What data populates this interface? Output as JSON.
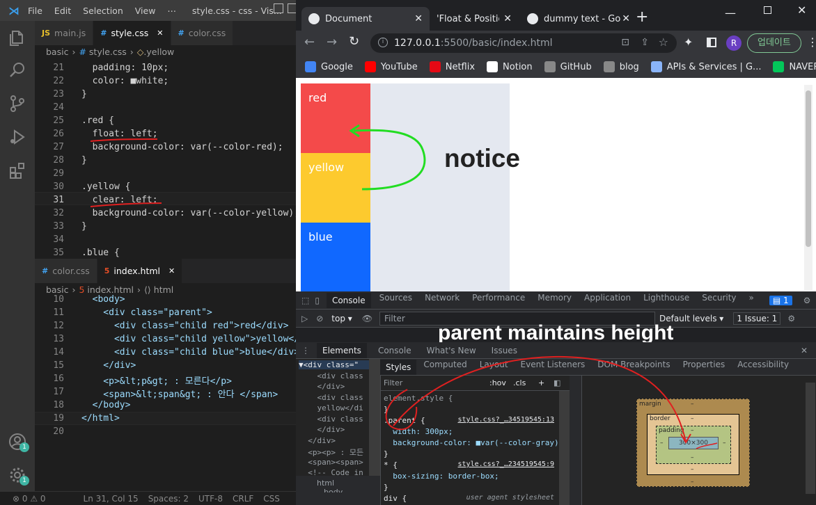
{
  "vscode": {
    "menu": [
      "File",
      "Edit",
      "Selection",
      "View",
      "⋯"
    ],
    "window_title": "style.css - css - Vis...",
    "tabs_top": [
      {
        "label": "main.js",
        "icon": "JS",
        "color": "#e8c02b"
      },
      {
        "label": "style.css",
        "icon": "#",
        "color": "#42a5f5"
      },
      {
        "label": "color.css",
        "icon": "#",
        "color": "#42a5f5"
      }
    ],
    "active_top_close": "✕",
    "breadcrumb_top": [
      "basic",
      "style.css",
      ".yellow"
    ],
    "css_lines": [
      {
        "ln": "21",
        "code": "  padding: 10px;"
      },
      {
        "ln": "22",
        "code": "  color: ■white;"
      },
      {
        "ln": "23",
        "code": "}"
      },
      {
        "ln": "24",
        "code": ""
      },
      {
        "ln": "25",
        "code": ".red {"
      },
      {
        "ln": "26",
        "code": "  float: left;"
      },
      {
        "ln": "27",
        "code": "  background-color: var(--color-red);"
      },
      {
        "ln": "28",
        "code": "}"
      },
      {
        "ln": "29",
        "code": ""
      },
      {
        "ln": "30",
        "code": ".yellow {"
      },
      {
        "ln": "31",
        "code": "  clear: left;"
      },
      {
        "ln": "32",
        "code": "  background-color: var(--color-yellow);"
      },
      {
        "ln": "33",
        "code": "}"
      },
      {
        "ln": "34",
        "code": ""
      },
      {
        "ln": "35",
        "code": ".blue {"
      }
    ],
    "tabs_bottom": [
      {
        "label": "color.css",
        "icon": "#",
        "color": "#42a5f5"
      },
      {
        "label": "index.html",
        "icon": "5",
        "color": "#e44d26"
      }
    ],
    "active_bottom_close": "✕",
    "breadcrumb_bottom": [
      "basic",
      "index.html",
      "html"
    ],
    "html_lines": [
      {
        "ln": "10",
        "code": "  <body>"
      },
      {
        "ln": "11",
        "code": "    <div class=\"parent\">"
      },
      {
        "ln": "12",
        "code": "      <div class=\"child red\">red</div>"
      },
      {
        "ln": "13",
        "code": "      <div class=\"child yellow\">yellow</"
      },
      {
        "ln": "14",
        "code": "      <div class=\"child blue\">blue</div>"
      },
      {
        "ln": "15",
        "code": "    </div>"
      },
      {
        "ln": "16",
        "code": "    <p>&lt;p&gt; : 모른다</p>"
      },
      {
        "ln": "17",
        "code": "    <span>&lt;span&gt; : 안다 </span>"
      },
      {
        "ln": "18",
        "code": "  </body>"
      },
      {
        "ln": "19",
        "code": "</html>"
      },
      {
        "ln": "20",
        "code": ""
      }
    ],
    "badges": [
      "1",
      "1"
    ],
    "status": {
      "problems": "⊗ 0 ⚠ 0",
      "position": "Ln 31, Col 15",
      "spaces": "Spaces: 2",
      "encoding": "UTF-8",
      "eol": "CRLF",
      "language": "CSS"
    }
  },
  "chrome": {
    "tabs": [
      {
        "label": "Document",
        "close": "✕"
      },
      {
        "label": "'Float & Position'",
        "close": "✕"
      },
      {
        "label": "dummy text - Go",
        "close": "✕"
      }
    ],
    "new_tab": "+",
    "url_host": "127.0.0.1",
    "url_rest": ":5500/basic/index.html",
    "profile_initial": "R",
    "update_button": "업데이트",
    "bookmarks": [
      {
        "label": "Google",
        "color": "#4285f4"
      },
      {
        "label": "YouTube",
        "color": "#ff0000"
      },
      {
        "label": "Netflix",
        "color": "#e50914"
      },
      {
        "label": "Notion",
        "color": "#ffffff"
      },
      {
        "label": "GitHub",
        "color": "#888888"
      },
      {
        "label": "blog",
        "color": "#888888"
      },
      {
        "label": "APIs & Services | G...",
        "color": "#8ab4f8"
      },
      {
        "label": "NAVER",
        "color": "#03c75a"
      }
    ],
    "bookmark_more": "»",
    "page": {
      "children": [
        {
          "label": "red",
          "color": "#f44a4a"
        },
        {
          "label": "yellow",
          "color": "#fdca2e"
        },
        {
          "label": "blue",
          "color": "#1068ff"
        }
      ],
      "parent_color": "#e4e8f0",
      "annotation": "notice"
    }
  },
  "devtools": {
    "top_tabs": [
      "Console",
      "Sources",
      "Network",
      "Performance",
      "Memory",
      "Application",
      "Lighthouse",
      "Security",
      "»"
    ],
    "msg_count": "1",
    "context": "top ▾",
    "filter_placeholder": "Filter",
    "levels": "Default levels ▾",
    "issues": "1 Issue: 1",
    "overlay_note": "parent maintains height",
    "drawer_tabs": [
      "Elements",
      "Console",
      "What's New",
      "Issues"
    ],
    "drawer_close": "✕",
    "elements_lines": [
      "▼<div class=\"",
      "    <div class",
      "    </div>",
      "    <div class",
      "    yellow</di",
      "    <div class",
      "    </div>",
      "  </div>",
      "  <p><p> : 모든",
      "  <span><span>",
      "  <!-- Code in"
    ],
    "element_crumbs": [
      "html",
      "body"
    ],
    "styles_tabs": [
      "Styles",
      "Computed",
      "Layout",
      "Event Listeners",
      "DOM Breakpoints",
      "Properties",
      "Accessibility"
    ],
    "styles_filter": "Filter",
    "styles_hov": ":hov",
    "styles_cls": ".cls",
    "style_lines": [
      {
        "text": "element.style {",
        "src": ""
      },
      {
        "text": "}",
        "src": ""
      },
      {
        "text": ".parent {",
        "src": "style.css?_…34519545:13"
      },
      {
        "text": "  width: 300px;",
        "src": ""
      },
      {
        "text": "  background-color: ■var(--color-gray);",
        "src": ""
      },
      {
        "text": "}",
        "src": ""
      },
      {
        "text": "* {",
        "src": "style.css?_…234519545:9"
      },
      {
        "text": "  box-sizing: border-box;",
        "src": ""
      },
      {
        "text": "}",
        "src": ""
      },
      {
        "text": "div {",
        "src": "user agent stylesheet"
      }
    ],
    "box_model": {
      "margin": "margin",
      "border": "border",
      "padding": "padding",
      "content": "300×300",
      "dash": "–"
    }
  }
}
